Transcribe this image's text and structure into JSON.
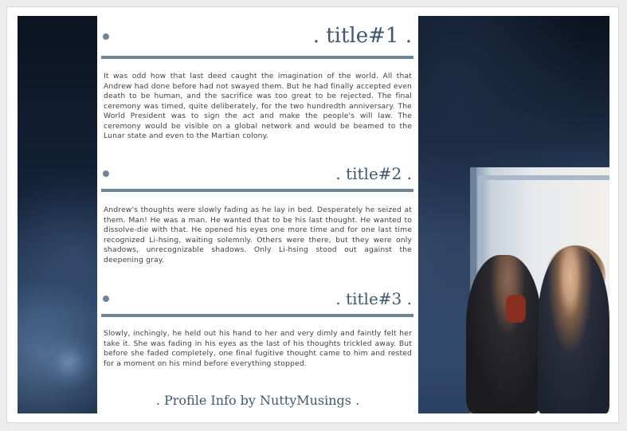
{
  "sections": [
    {
      "title": ". title#1 .",
      "text": "It was odd how that last deed caught the imagination of the world. All that Andrew had done before had not swayed them. But he had finally accepted even death to be human, and the sacrifice was too great to be rejected. The final ceremony was timed, quite deliberately, for the two hundredth anniversary. The World President was to sign the act and make the people's will law. The ceremony would be visible on a global network and would be beamed to the Lunar state and even to the Martian colony."
    },
    {
      "title": ". title#2 .",
      "text": "Andrew's thoughts were slowly fading as he lay in bed. Desperately he seized at them. Man! He was a man. He wanted that to be his last thought. He wanted to dissolve-die with that. He opened his eyes one more time and for one last time recognized Li-hsing, waiting solemnly. Others were there, but they were only shadows, unrecognizable shadows. Only Li-hsing stood out against the deepening gray."
    },
    {
      "title": ". title#3 .",
      "text": "Slowly, inchingly, he held out his hand to her and very dimly and faintly felt her take it. She was fading in his eyes as the last of his thoughts trickled away. But before she faded completely, one final fugitive thought came to him and rested for a moment on his mind before everything stopped."
    }
  ],
  "footer": ". Profile Info by NuttyMusings .",
  "colors": {
    "accent": "#6f8698",
    "title": "#3f5870",
    "text": "#404040",
    "page_bg": "#ececec"
  },
  "icons": [
    "bullet-dot-icon"
  ]
}
